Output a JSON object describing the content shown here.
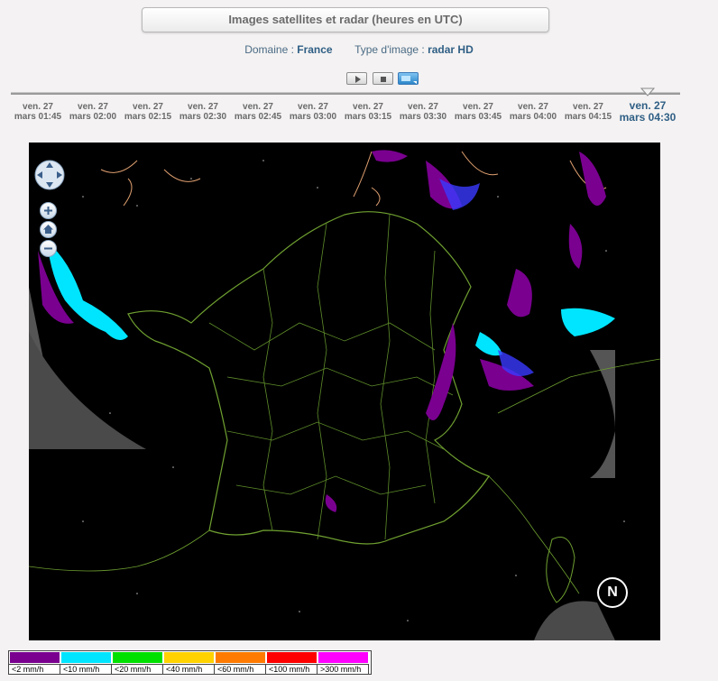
{
  "header": {
    "title": "Images satellites et radar (heures en UTC)"
  },
  "selection": {
    "domain_label": "Domaine : ",
    "domain_value": "France",
    "type_label": "Type d'image : ",
    "type_value": "radar HD"
  },
  "controls": {
    "play": "play-icon",
    "stop": "stop-icon",
    "image": "image-icon"
  },
  "timeline": {
    "ticks": [
      {
        "day": "ven. 27",
        "time": "mars 01:45"
      },
      {
        "day": "ven. 27",
        "time": "mars 02:00"
      },
      {
        "day": "ven. 27",
        "time": "mars 02:15"
      },
      {
        "day": "ven. 27",
        "time": "mars 02:30"
      },
      {
        "day": "ven. 27",
        "time": "mars 02:45"
      },
      {
        "day": "ven. 27",
        "time": "mars 03:00"
      },
      {
        "day": "ven. 27",
        "time": "mars 03:15"
      },
      {
        "day": "ven. 27",
        "time": "mars 03:30"
      },
      {
        "day": "ven. 27",
        "time": "mars 03:45"
      },
      {
        "day": "ven. 27",
        "time": "mars 04:00"
      },
      {
        "day": "ven. 27",
        "time": "mars 04:15"
      },
      {
        "day": "ven. 27",
        "time": "mars 04:30"
      }
    ],
    "active_index": 11
  },
  "map": {
    "north_label": "N"
  },
  "legend": [
    {
      "label": "<2 mm/h",
      "color": "#7a0090"
    },
    {
      "label": "<10 mm/h",
      "color": "#00e5ff"
    },
    {
      "label": "<20 mm/h",
      "color": "#00e000"
    },
    {
      "label": "<40 mm/h",
      "color": "#ffd200"
    },
    {
      "label": "<60 mm/h",
      "color": "#ff7a00"
    },
    {
      "label": "<100 mm/h",
      "color": "#ff0000"
    },
    {
      "label": ">300 mm/h",
      "color": "#ff00ff"
    }
  ]
}
